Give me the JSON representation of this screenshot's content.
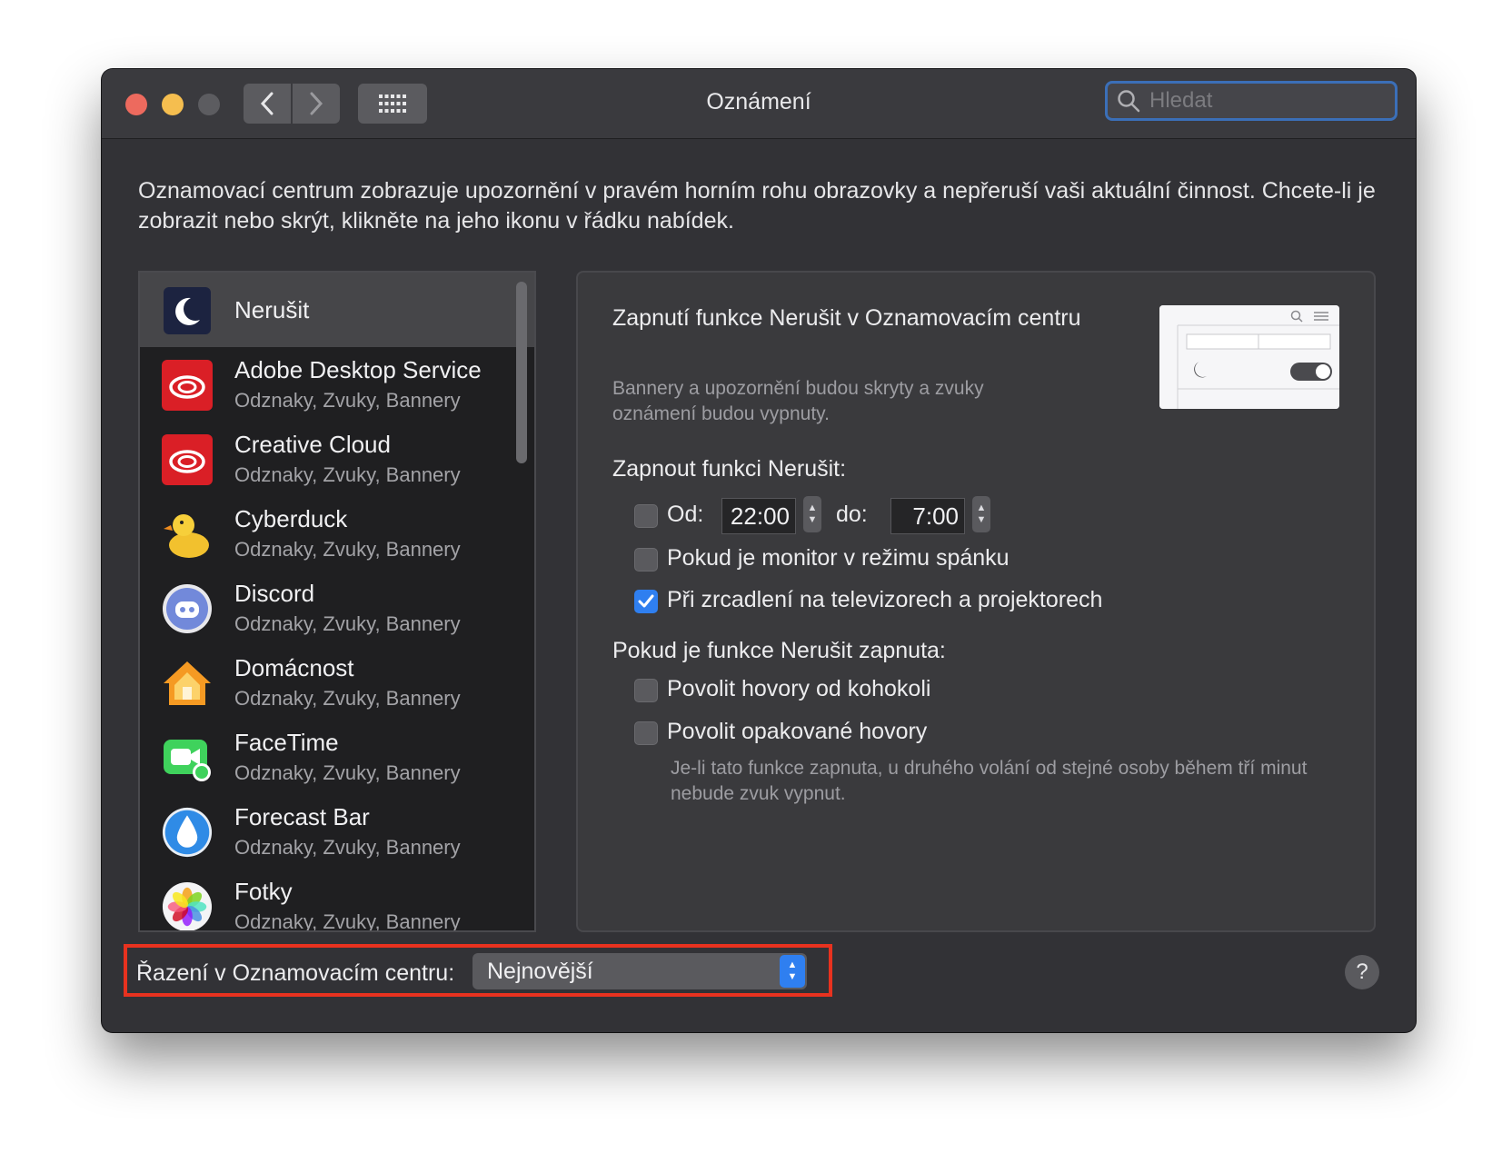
{
  "window": {
    "title": "Oznámení"
  },
  "search": {
    "placeholder": "Hledat"
  },
  "description": "Oznamovací centrum zobrazuje upozornění v pravém horním rohu obrazovky a nepřeruší vaši aktuální činnost. Chcete-li je zobrazit nebo skrýt, klikněte na jeho ikonu v řádku nabídek.",
  "apps": [
    {
      "name": "Nerušit",
      "sub": "",
      "icon": "moon-icon"
    },
    {
      "name": "Adobe Desktop Service",
      "sub": "Odznaky, Zvuky, Bannery",
      "icon": "creative-cloud-icon"
    },
    {
      "name": "Creative Cloud",
      "sub": "Odznaky, Zvuky, Bannery",
      "icon": "creative-cloud-icon"
    },
    {
      "name": "Cyberduck",
      "sub": "Odznaky, Zvuky, Bannery",
      "icon": "duck-icon"
    },
    {
      "name": "Discord",
      "sub": "Odznaky, Zvuky, Bannery",
      "icon": "discord-icon"
    },
    {
      "name": "Domácnost",
      "sub": "Odznaky, Zvuky, Bannery",
      "icon": "home-icon"
    },
    {
      "name": "FaceTime",
      "sub": "Odznaky, Zvuky, Bannery",
      "icon": "facetime-icon"
    },
    {
      "name": "Forecast Bar",
      "sub": "Odznaky, Zvuky, Bannery",
      "icon": "raindrop-icon"
    },
    {
      "name": "Fotky",
      "sub": "Odznaky, Zvuky, Bannery",
      "icon": "photos-icon"
    }
  ],
  "panel": {
    "title": "Zapnutí funkce Nerušit v Oznamovacím centru",
    "subtitle": "Bannery a upozornění budou skryty a zvuky oznámení budou vypnuty.",
    "turn_on_heading": "Zapnout funkci Nerušit:",
    "from_label": "Od:",
    "from_time": "22:00",
    "to_label": "do:",
    "to_time": "7:00",
    "sleep_label": "Pokud je monitor v režimu spánku",
    "mirror_label": "Při zrcadlení na televizorech a projektorech",
    "when_on_heading": "Pokud je funkce Nerušit zapnuta:",
    "allow_calls_label": "Povolit hovory od kohokoli",
    "repeated_calls_label": "Povolit opakované hovory",
    "note": "Je-li tato funkce zapnuta, u druhého volání od stejné osoby během tří minut nebude zvuk vypnut."
  },
  "sort": {
    "label": "Řazení v Oznamovacím centru:",
    "value": "Nejnovější"
  },
  "help": {
    "label": "?"
  },
  "colors": {
    "accent": "#2f7ff0",
    "highlight": "#e8321f"
  }
}
